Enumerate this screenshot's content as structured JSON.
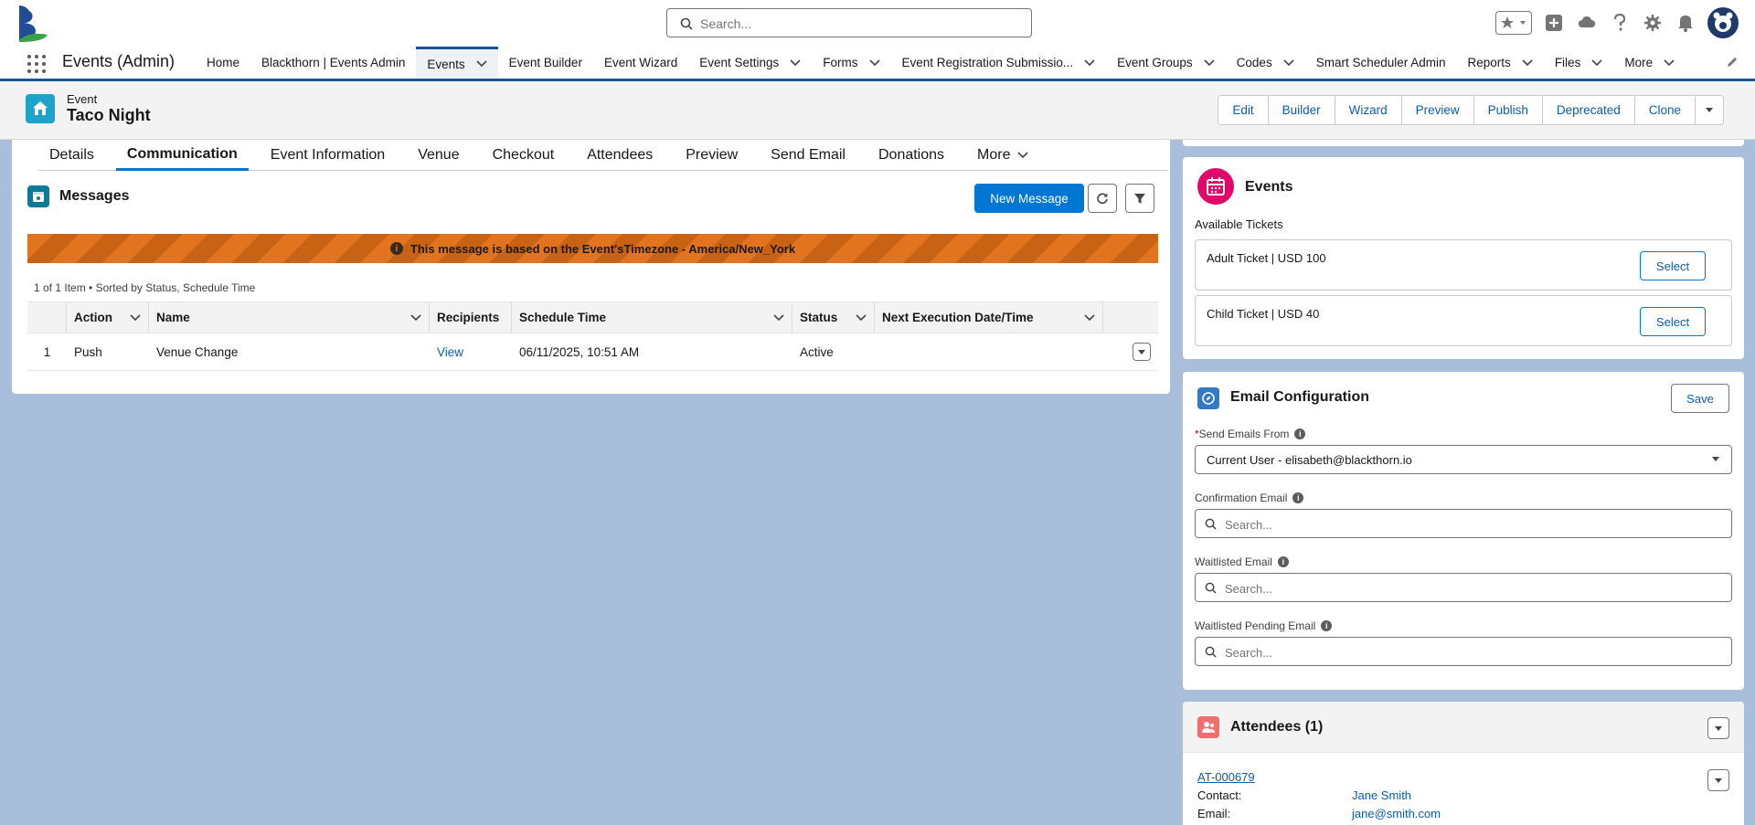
{
  "header": {
    "search_placeholder": "Search..."
  },
  "nav": {
    "app_name": "Events (Admin)",
    "items": [
      {
        "label": "Home",
        "chevron": false,
        "active": false
      },
      {
        "label": "Blackthorn | Events Admin",
        "chevron": false,
        "active": false
      },
      {
        "label": "Events",
        "chevron": true,
        "active": true
      },
      {
        "label": "Event Builder",
        "chevron": false,
        "active": false
      },
      {
        "label": "Event Wizard",
        "chevron": false,
        "active": false
      },
      {
        "label": "Event Settings",
        "chevron": true,
        "active": false
      },
      {
        "label": "Forms",
        "chevron": true,
        "active": false
      },
      {
        "label": "Event Registration Submissio...",
        "chevron": true,
        "active": false
      },
      {
        "label": "Event Groups",
        "chevron": true,
        "active": false
      },
      {
        "label": "Codes",
        "chevron": true,
        "active": false
      },
      {
        "label": "Smart Scheduler Admin",
        "chevron": false,
        "active": false
      },
      {
        "label": "Reports",
        "chevron": true,
        "active": false
      },
      {
        "label": "Files",
        "chevron": true,
        "active": false
      },
      {
        "label": "More",
        "chevron": true,
        "active": false
      }
    ]
  },
  "record": {
    "type": "Event",
    "title": "Taco Night",
    "actions": [
      "Edit",
      "Builder",
      "Wizard",
      "Preview",
      "Publish",
      "Deprecated",
      "Clone"
    ]
  },
  "tabs": {
    "items": [
      "Details",
      "Communication",
      "Event Information",
      "Venue",
      "Checkout",
      "Attendees",
      "Preview",
      "Send Email",
      "Donations"
    ],
    "active": "Communication",
    "more": "More"
  },
  "messages": {
    "title": "Messages",
    "new_button": "New Message",
    "banner": "This message is based on the Event'sTimezone - America/New_York",
    "table_info": "1 of 1 Item • Sorted by Status, Schedule Time",
    "columns": [
      "Action",
      "Name",
      "Recipients",
      "Schedule Time",
      "Status",
      "Next Execution Date/Time"
    ],
    "rows": [
      {
        "num": "1",
        "action": "Push",
        "name": "Venue Change",
        "recipients": "View",
        "schedule": "06/11/2025, 10:51 AM",
        "status": "Active",
        "next": ""
      }
    ]
  },
  "events_card": {
    "title": "Events",
    "available_label": "Available Tickets",
    "tickets": [
      {
        "label": "Adult Ticket | USD 100",
        "button": "Select"
      },
      {
        "label": "Child Ticket | USD 40",
        "button": "Select"
      }
    ]
  },
  "email_config": {
    "title": "Email Configuration",
    "save": "Save",
    "send_from_label": "Send Emails From",
    "send_from_value": "Current User - elisabeth@blackthorn.io",
    "confirmation_label": "Confirmation Email",
    "waitlisted_label": "Waitlisted Email",
    "waitlisted_pending_label": "Waitlisted Pending Email",
    "search_placeholder": "Search..."
  },
  "attendees": {
    "title": "Attendees (1)",
    "record_id": "AT-000679",
    "contact_label": "Contact:",
    "contact_value": "Jane Smith",
    "email_label": "Email:",
    "email_value": "jane@smith.com"
  },
  "colors": {
    "brand_blue": "#0176d3",
    "nav_accent": "#1b5297",
    "banner_orange": "#e2741f",
    "events_pink": "#e3066a",
    "record_teal": "#1ca3c9"
  }
}
